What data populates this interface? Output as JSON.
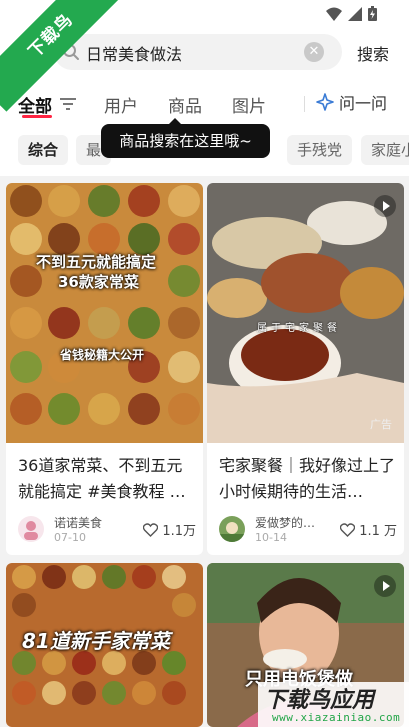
{
  "watermark_corner": "下载鸟",
  "search": {
    "query": "日常美食做法",
    "button": "搜索"
  },
  "tabs": [
    {
      "label": "全部"
    },
    {
      "label": "用户"
    },
    {
      "label": "商品"
    },
    {
      "label": "图片"
    }
  ],
  "ask_label": "问一问",
  "tooltip": "商品搜索在这里哦~",
  "chips": [
    "综合",
    "最",
    "手残党",
    "家庭小"
  ],
  "cards": [
    {
      "image_text_1": "不到五元就能搞定",
      "image_text_2": "36款家常菜",
      "image_text_3": "省钱秘籍大公开",
      "title": "36道家常菜、不到五元就能搞定 #美食教程 …",
      "author": "诺诺美食",
      "date": "07-10",
      "likes": "1.1万"
    },
    {
      "image_text_1": "属于宅家聚餐",
      "ad": "广告",
      "title": "宅家聚餐｜我好像过上了小时候期待的生活…",
      "author": "爱做梦的…",
      "date": "10-14",
      "likes": "1.1 万"
    },
    {
      "image_text_1": "81道新手家常菜"
    },
    {
      "image_text_1": "只用电饭煲做"
    }
  ],
  "watermark_app": {
    "big": "下载鸟应用",
    "small": "www.xiazainiao.com"
  },
  "colors": {
    "accent": "#ff2442",
    "ribbon": "#23a94f"
  }
}
